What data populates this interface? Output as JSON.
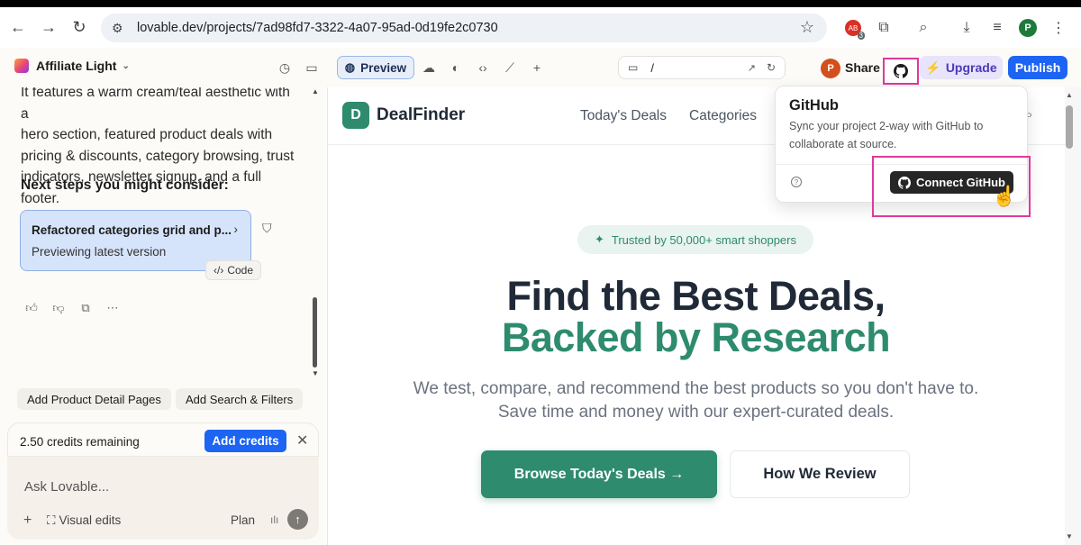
{
  "browser": {
    "url": "lovable.dev/projects/7ad98fd7-3322-4a07-95ad-0d19fe2c0730",
    "extension_count": "3",
    "profile_initial": "P"
  },
  "appbar": {
    "project_name": "Affiliate Light",
    "preview_label": "Preview",
    "route": "/",
    "avatar_initial": "P",
    "share_label": "Share",
    "upgrade_label": "Upgrade",
    "publish_label": "Publish"
  },
  "chat": {
    "message_lines": [
      "It features a warm cream/teal aesthetic with a",
      "hero section, featured product deals with",
      "pricing & discounts, category browsing, trust",
      "indicators, newsletter signup, and a full footer."
    ],
    "next_steps": "Next steps you might consider:",
    "version_title": "Refactored categories grid and p...",
    "version_sub": "Previewing latest version",
    "code_label": "Code",
    "suggestions": [
      "Add Product Detail Pages",
      "Add Search & Filters"
    ],
    "credits_text": "2.50 credits remaining",
    "add_credits_label": "Add credits",
    "input_placeholder": "Ask Lovable...",
    "visual_edits_label": "Visual edits",
    "plan_label": "Plan"
  },
  "site": {
    "logo_letter": "D",
    "logo_name": "DealFinder",
    "nav": [
      "Today's Deals",
      "Categories"
    ],
    "trusted_badge": "Trusted by 50,000+ smart shoppers",
    "hero_line1": "Find the Best Deals,",
    "hero_line2": "Backed by Research",
    "hero_sub1": "We test, compare, and recommend the best products so you don't have to.",
    "hero_sub2": "Save time and money with our expert-curated deals.",
    "cta_primary": "Browse Today's Deals →",
    "cta_secondary": "How We Review"
  },
  "github_popover": {
    "title": "GitHub",
    "description": "Sync your project 2-way with GitHub to collaborate at source.",
    "connect_label": "Connect GitHub"
  },
  "colors": {
    "brand_green": "#2e8b6e",
    "publish_blue": "#1d64f2",
    "highlight_pink": "#e0399c",
    "upgrade_purple": "#4b3ab7"
  }
}
